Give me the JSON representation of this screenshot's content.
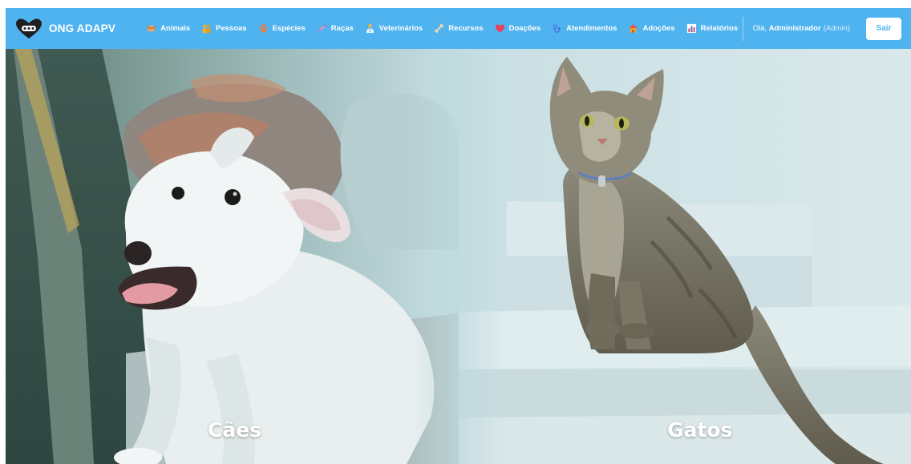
{
  "brand": {
    "name": "ONG ADAPV",
    "logo_icon": "heart-paw-logo-icon"
  },
  "nav": {
    "items": [
      {
        "label": "Animais",
        "icon": "dog-icon",
        "color": "#f5a35c"
      },
      {
        "label": "Pessoas",
        "icon": "people-icon",
        "color": "#f0b429"
      },
      {
        "label": "Espécies",
        "icon": "paw-icon",
        "color": "#f27a3a"
      },
      {
        "label": "Raças",
        "icon": "syringe-icon",
        "color": "#e88bc9"
      },
      {
        "label": "Veterinários",
        "icon": "veterinarian-icon",
        "color": "#f3b33d"
      },
      {
        "label": "Recursos",
        "icon": "bone-icon",
        "color": "#f2d6a9"
      },
      {
        "label": "Doações",
        "icon": "heart-icon",
        "color": "#e8405b"
      },
      {
        "label": "Atendimentos",
        "icon": "stethoscope-icon",
        "color": "#4a6fd8"
      },
      {
        "label": "Adoções",
        "icon": "house-icon",
        "color": "#e9a23b"
      },
      {
        "label": "Relatórios",
        "icon": "bar-chart-icon",
        "color": "#e74c5c"
      }
    ]
  },
  "user": {
    "greeting_prefix": "Olá,",
    "name": "Administrador",
    "role": "(Admin)",
    "logout_label": "Sair"
  },
  "hero": {
    "dogs_label": "Cães",
    "cats_label": "Gatos"
  },
  "colors": {
    "navbar": "#4fb3f0",
    "overlay_tint": "#cfe3e8",
    "logout_text": "#4fb3f0"
  }
}
